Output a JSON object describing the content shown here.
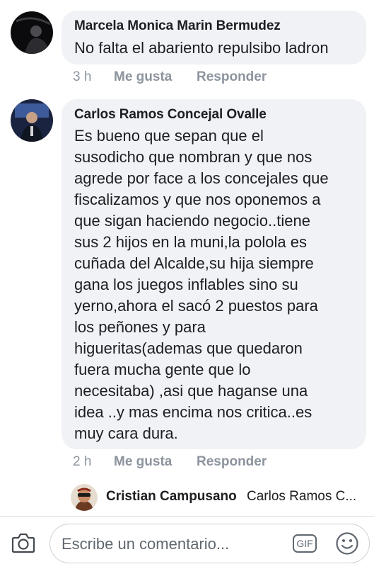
{
  "comments": [
    {
      "author": "Marcela Monica Marin Bermudez",
      "text": "No falta el abariento repulsibo ladron",
      "time": "3 h",
      "like_label": "Me gusta",
      "reply_label": "Responder"
    },
    {
      "author": "Carlos Ramos Concejal Ovalle",
      "lines": [
        "Es bueno que sepan que el",
        "susodicho que nombran y que nos",
        "agrede por face a los concejales que",
        "fiscalizamos y que nos oponemos a",
        "que sigan haciendo negocio..tiene",
        "sus 2 hijos en la muni,la polola es",
        "cuñada del Alcalde,su hija siempre",
        "gana los juegos inflables sino su",
        "yerno,ahora el sacó 2 puestos para",
        "los peñones y para",
        "higueritas(ademas que quedaron",
        "fuera mucha gente que lo",
        "necesitaba) ,asi que haganse una",
        "idea ..y mas encima nos critica..es",
        "muy cara dura."
      ],
      "time": "2 h",
      "like_label": "Me gusta",
      "reply_label": "Responder"
    }
  ],
  "reply_preview": {
    "name": "Cristian Campusano",
    "snippet": "Carlos Ramos C..."
  },
  "composer": {
    "placeholder": "Escribe un comentario...",
    "gif_label": "GIF",
    "camera_icon": "camera-icon",
    "emoji_icon": "emoji-icon"
  },
  "colors": {
    "bubble": "#f0f2f5",
    "meta_text": "#8d949e",
    "text": "#1c1e21"
  }
}
